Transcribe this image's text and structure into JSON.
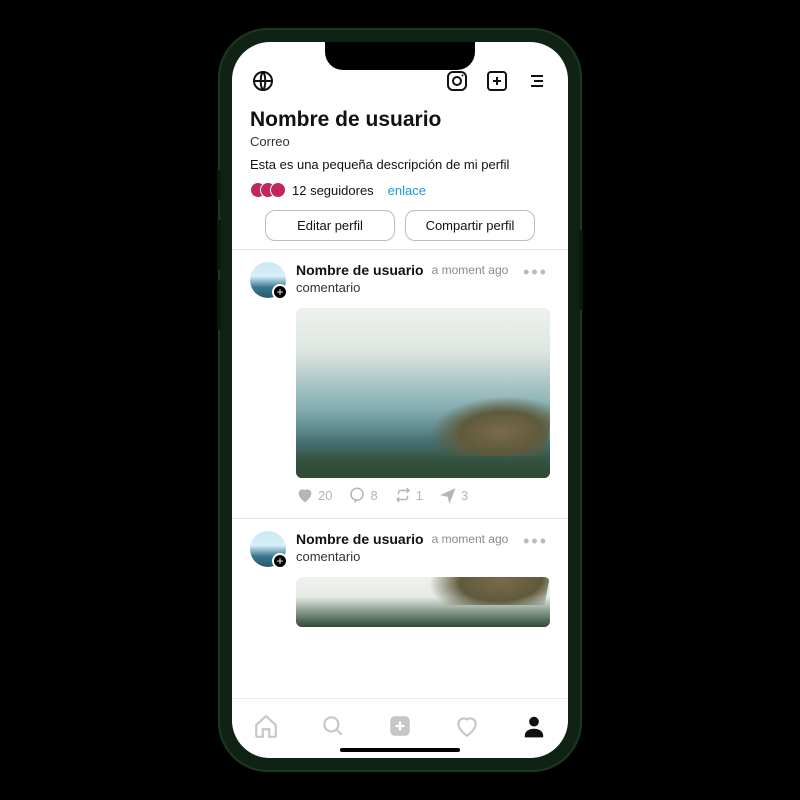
{
  "header": {
    "icons": {
      "globe": "globe-icon",
      "camera": "camera-icon",
      "add": "add-box-icon",
      "menu": "menu-icon"
    }
  },
  "profile": {
    "username": "Nombre de usuario",
    "email": "Correo",
    "bio": "Esta es una pequeña descripción de mi perfil",
    "followers_text": "12 seguidores",
    "link_text": "enlace",
    "buttons": {
      "edit": "Editar perfil",
      "share": "Compartir perfil"
    }
  },
  "posts": [
    {
      "username": "Nombre de usuario",
      "time": "a moment ago",
      "comment": "comentario",
      "likes": "20",
      "replies": "8",
      "reposts": "1",
      "shares": "3"
    },
    {
      "username": "Nombre de usuario",
      "time": "a moment ago",
      "comment": "comentario"
    }
  ],
  "nav": {
    "items": [
      "home",
      "search",
      "create",
      "likes",
      "profile"
    ],
    "active": "profile"
  }
}
